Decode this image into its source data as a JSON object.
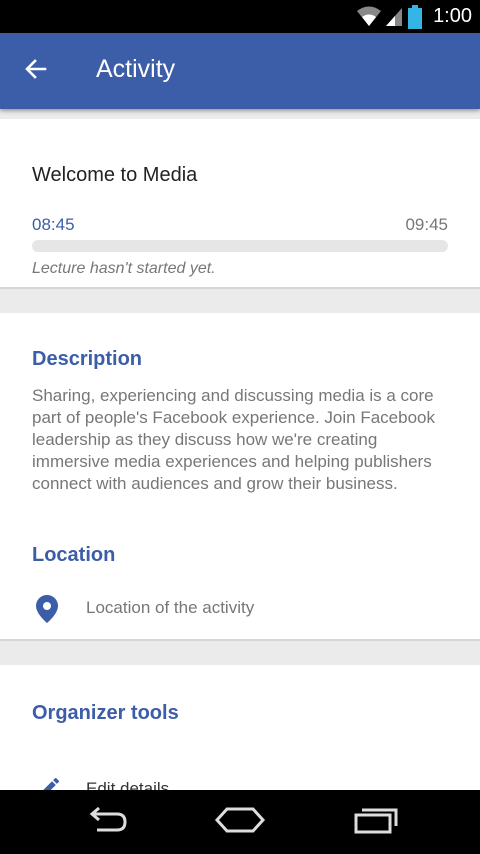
{
  "status_bar": {
    "time": "1:00"
  },
  "app_bar": {
    "title": "Activity",
    "back_icon": "arrow-back-icon"
  },
  "lecture": {
    "title": "Welcome to Media",
    "start_time": "08:45",
    "end_time": "09:45",
    "progress": 0,
    "status": "Lecture hasn't started yet."
  },
  "description": {
    "heading": "Description",
    "text": "Sharing, experiencing and discussing media is a core part of people's Facebook experience. Join Facebook leadership as they discuss how we're creating immersive media experiences and helping publishers connect with audiences and grow their business."
  },
  "location": {
    "heading": "Location",
    "icon": "location-pin-icon",
    "text": "Location of the activity"
  },
  "organizer_tools": {
    "heading": "Organizer tools",
    "edit_icon": "pencil-icon",
    "edit_label": "Edit details"
  },
  "colors": {
    "accent": "#3c5da8",
    "secondary_text": "#777777",
    "background": "#ebebeb"
  }
}
